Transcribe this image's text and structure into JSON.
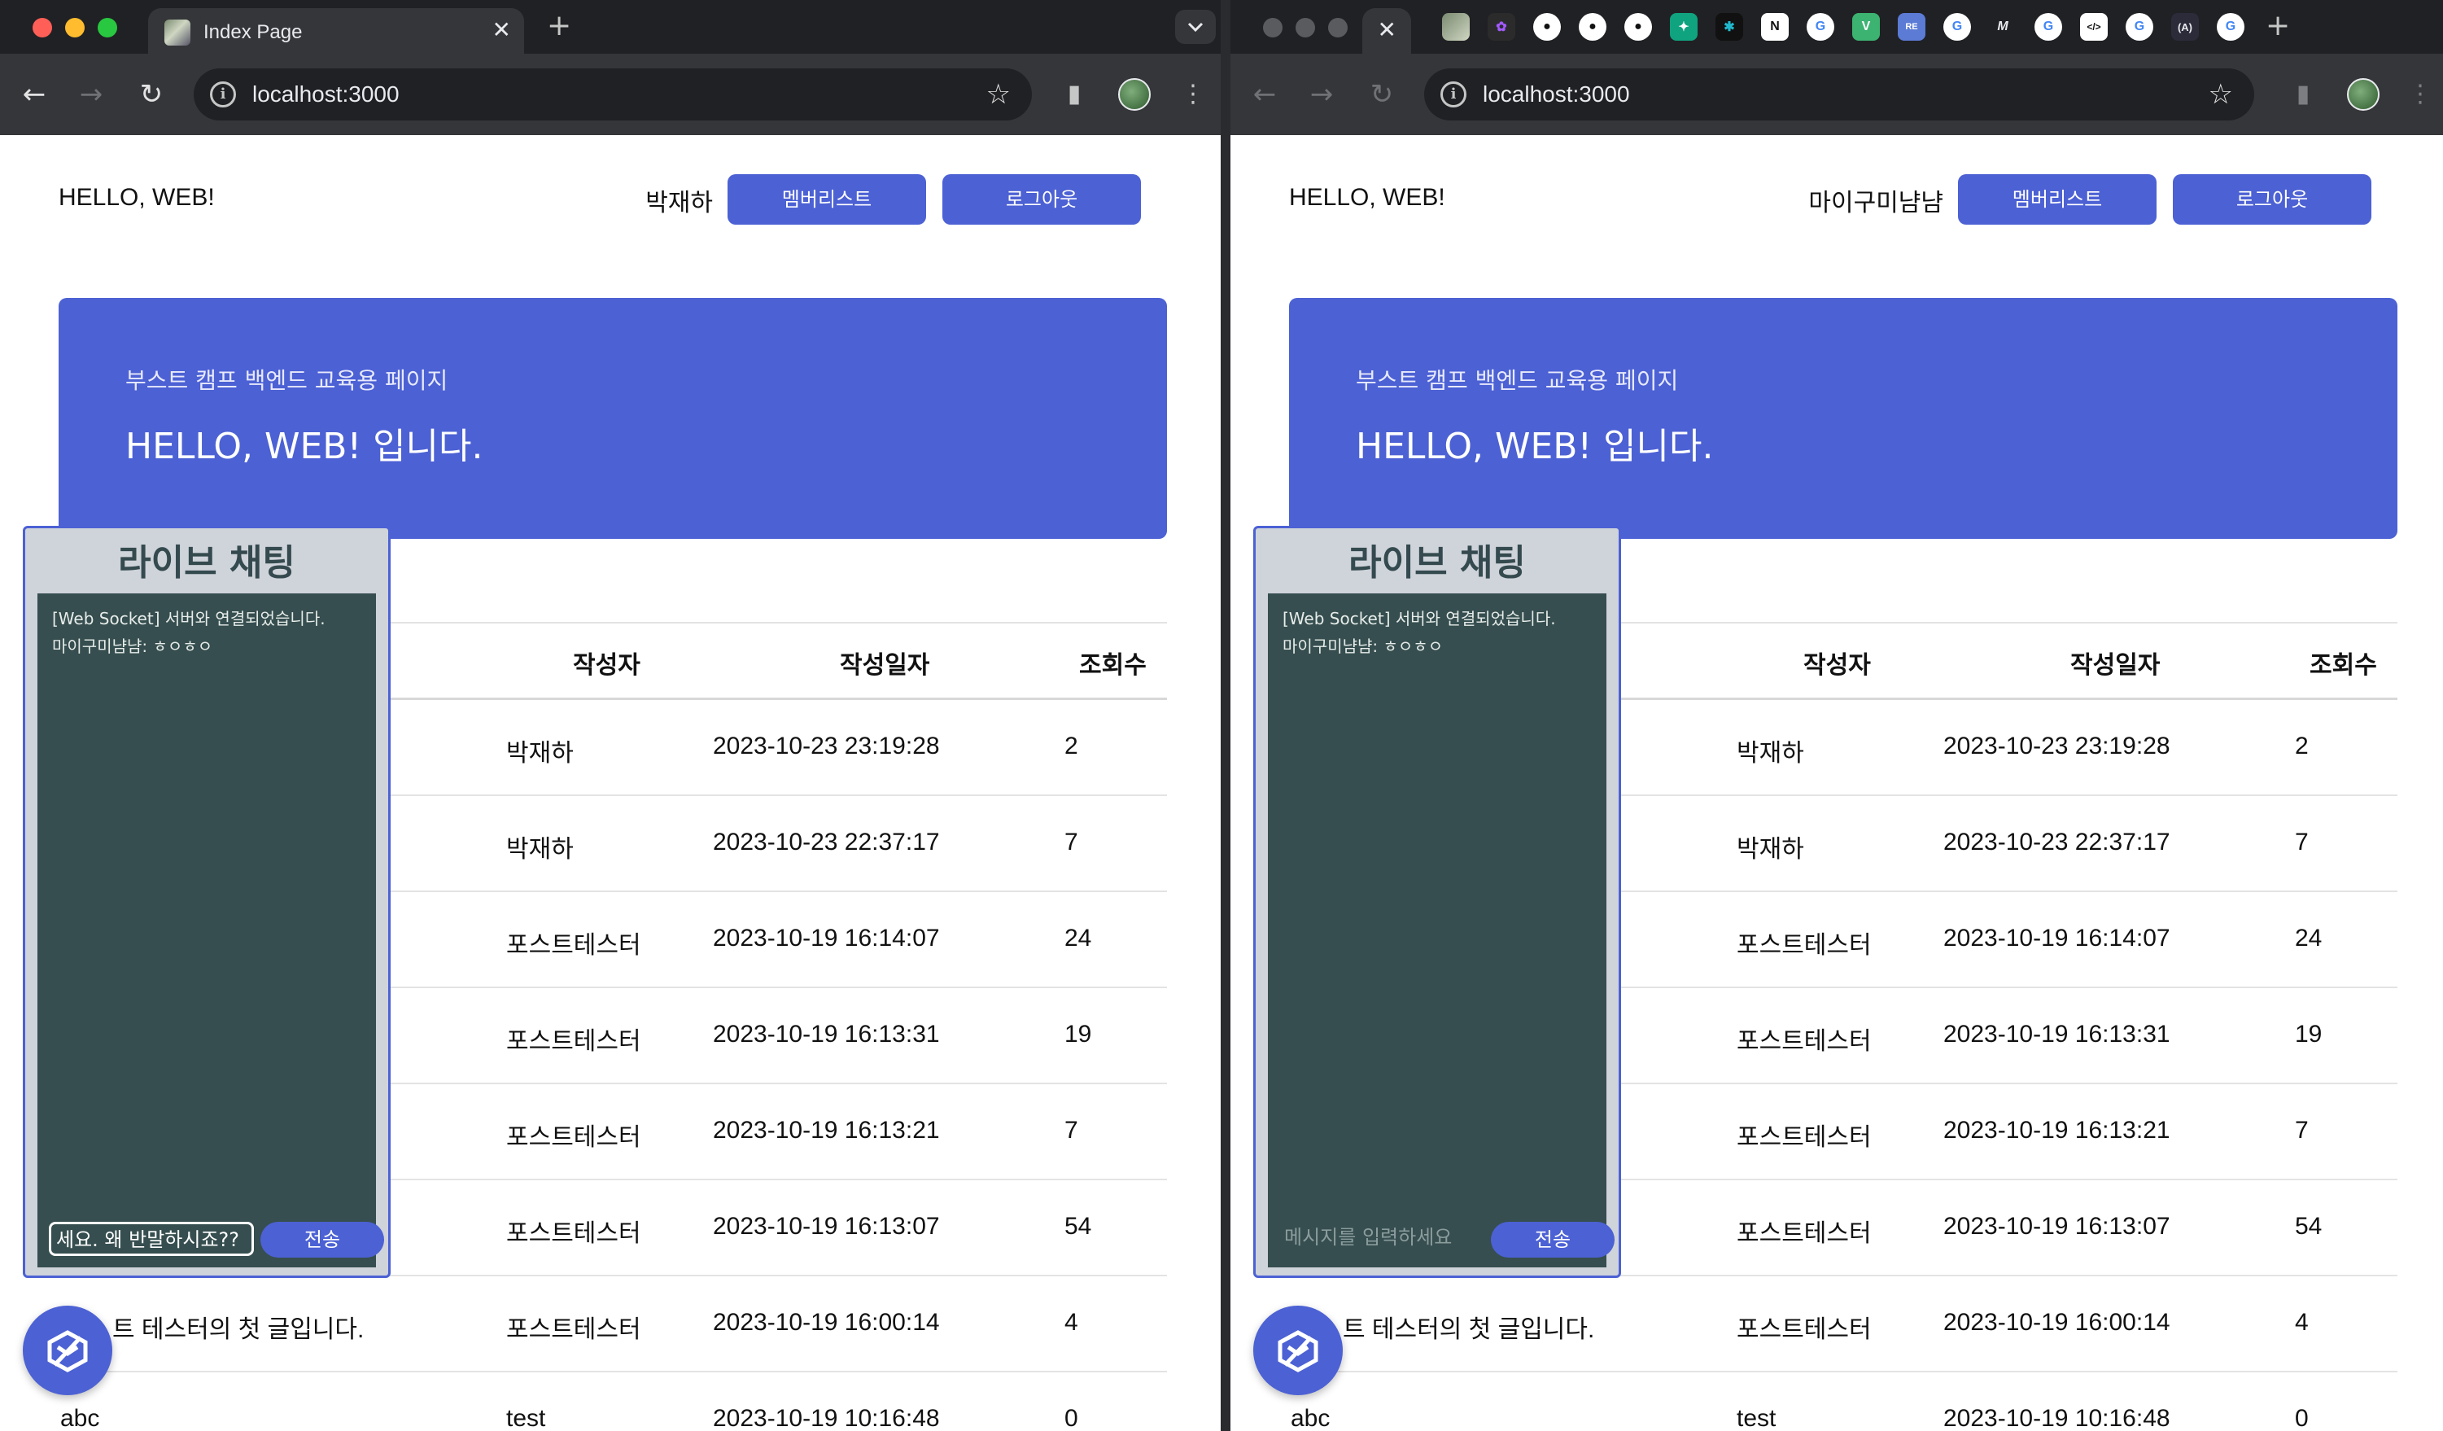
{
  "left": {
    "tab": {
      "title": "Index Page",
      "close": "✕",
      "new_tab": "+"
    },
    "url": "localhost:3000",
    "page": {
      "site_title": "HELLO, WEB!",
      "user": "박재하",
      "member_list_btn": "멤버리스트",
      "logout_btn": "로그아웃",
      "hero_sub": "부스트 캠프 백엔드 교육용 페이지",
      "hero_title": "HELLO, WEB! 입니다."
    },
    "chat": {
      "title": "라이브 채팅",
      "messages": [
        "[Web Socket] 서버와 연결되었습니다.",
        "마이구미냠냠: ㅎㅇㅎㅇ"
      ],
      "input_value": "세요. 왜 반말하시죠??",
      "send": "전송"
    }
  },
  "right": {
    "tab": {
      "close": "✕",
      "new_tab": "+"
    },
    "url": "localhost:3000",
    "page": {
      "site_title": "HELLO, WEB!",
      "user": "마이구미냠냠",
      "member_list_btn": "멤버리스트",
      "logout_btn": "로그아웃",
      "hero_sub": "부스트 캠프 백엔드 교육용 페이지",
      "hero_title": "HELLO, WEB! 입니다."
    },
    "chat": {
      "title": "라이브 채팅",
      "messages": [
        "[Web Socket] 서버와 연결되었습니다.",
        "마이구미냠냠: ㅎㅇㅎㅇ"
      ],
      "input_placeholder": "메시지를 입력하세요",
      "send": "전송"
    },
    "pinned_tabs": [
      "vim-tab",
      "figma",
      "github",
      "github",
      "github",
      "chatgpt",
      "perplexity",
      "notion",
      "google",
      "vue",
      "repo",
      "google",
      "medium",
      "google",
      "code",
      "google",
      "arc",
      "google"
    ]
  },
  "table": {
    "headers": {
      "author": "작성자",
      "date": "작성일자",
      "views": "조회수"
    },
    "rows": [
      {
        "title": "",
        "author": "박재하",
        "date": "2023-10-23 23:19:28",
        "views": "2"
      },
      {
        "title": "",
        "author": "박재하",
        "date": "2023-10-23 22:37:17",
        "views": "7"
      },
      {
        "title": "",
        "author": "포스트테스터",
        "date": "2023-10-19 16:14:07",
        "views": "24"
      },
      {
        "title": "",
        "author": "포스트테스터",
        "date": "2023-10-19 16:13:31",
        "views": "19"
      },
      {
        "title": "",
        "author": "포스트테스터",
        "date": "2023-10-19 16:13:21",
        "views": "7"
      },
      {
        "title": "",
        "author": "포스트테스터",
        "date": "2023-10-19 16:13:07",
        "views": "54"
      },
      {
        "title": "트 테스터의 첫 글입니다.",
        "author": "포스트테스터",
        "date": "2023-10-19 16:00:14",
        "views": "4"
      },
      {
        "title": "abc",
        "author": "test",
        "date": "2023-10-19 10:16:48",
        "views": "0"
      }
    ]
  },
  "colors": {
    "accent": "#4c61d4",
    "chat_bg": "#364e4f",
    "chat_panel": "#cfd3da",
    "chrome_dark": "#202124",
    "chrome_toolbar": "#35363a"
  }
}
